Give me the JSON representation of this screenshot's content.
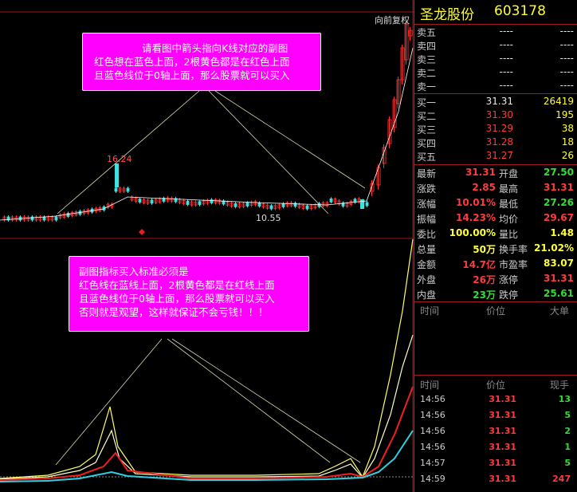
{
  "chart": {
    "mode_label": "向前复权",
    "peak_label": "16.24",
    "low_label": "10.55",
    "callout_top": [
      "请看图中箭头指向K线对应的副图",
      "红色想在蓝色上面，2根黄色都是在红色上面",
      "且蓝色线位于0轴上面，那么股票就可以买入"
    ],
    "callout_bottom": [
      "副图指标买入标准必须是",
      "红色线在蓝线上面，2根黄色都是在红线上面",
      "且蓝色线位于0轴上面，那么股票就可以买入",
      "否则就是观望，这样就保证不会亏钱！！！"
    ]
  },
  "quote": {
    "name": "圣龙股份",
    "code": "603178",
    "asks": [
      {
        "label": "卖五",
        "price": "----",
        "vol": "----"
      },
      {
        "label": "卖四",
        "price": "----",
        "vol": "----"
      },
      {
        "label": "卖三",
        "price": "----",
        "vol": "----"
      },
      {
        "label": "卖二",
        "price": "----",
        "vol": "----"
      },
      {
        "label": "卖一",
        "price": "----",
        "vol": "----"
      }
    ],
    "bids": [
      {
        "label": "买一",
        "price": "31.31",
        "vol": "26419",
        "pcolor": "white"
      },
      {
        "label": "买二",
        "price": "31.30",
        "vol": "195",
        "pcolor": "red"
      },
      {
        "label": "买三",
        "price": "31.29",
        "vol": "38",
        "pcolor": "red"
      },
      {
        "label": "买四",
        "price": "31.28",
        "vol": "18",
        "pcolor": "red"
      },
      {
        "label": "买五",
        "price": "31.27",
        "vol": "26",
        "pcolor": "red"
      }
    ],
    "stats": [
      {
        "k1": "最新",
        "v1": "31.31",
        "c1": "red",
        "k2": "开盘",
        "v2": "27.50",
        "c2": "green"
      },
      {
        "k1": "涨跌",
        "v1": "2.85",
        "c1": "red",
        "k2": "最高",
        "v2": "31.31",
        "c2": "red"
      },
      {
        "k1": "涨幅",
        "v1": "10.01%",
        "c1": "red",
        "k2": "最低",
        "v2": "27.26",
        "c2": "green"
      },
      {
        "k1": "振幅",
        "v1": "14.23%",
        "c1": "red",
        "k2": "均价",
        "v2": "29.67",
        "c2": "red"
      },
      {
        "k1": "委比",
        "v1": "100.00%",
        "c1": "yellow",
        "k2": "量比",
        "v2": "1.48",
        "c2": "yellow"
      },
      {
        "k1": "总量",
        "v1": "50万",
        "c1": "yellow",
        "k2": "换手率",
        "v2": "21.02%",
        "c2": "yellow"
      },
      {
        "k1": "金额",
        "v1": "14.7亿",
        "c1": "red",
        "k2": "市盈率",
        "v2": "83.07",
        "c2": "yellow"
      },
      {
        "k1": "外盘",
        "v1": "26万",
        "c1": "red",
        "k2": "涨停",
        "v2": "31.31",
        "c2": "red"
      },
      {
        "k1": "内盘",
        "v1": "23万",
        "c1": "green",
        "k2": "跌停",
        "v2": "25.61",
        "c2": "green"
      }
    ],
    "big_header": {
      "time": "时间",
      "price": "价位",
      "big": "大单"
    },
    "tick_header": {
      "time": "时间",
      "price": "价位",
      "vol": "现手"
    },
    "ticks": [
      {
        "time": "14:56",
        "price": "31.31",
        "vol": "13",
        "vcolor": "green"
      },
      {
        "time": "14:56",
        "price": "31.31",
        "vol": "5",
        "vcolor": "green"
      },
      {
        "time": "14:56",
        "price": "31.31",
        "vol": "2",
        "vcolor": "green"
      },
      {
        "time": "14:56",
        "price": "31.31",
        "vol": "1",
        "vcolor": "green"
      },
      {
        "time": "14:57",
        "price": "31.31",
        "vol": "5",
        "vcolor": "green"
      },
      {
        "time": "14:59",
        "price": "31.31",
        "vol": "247",
        "vcolor": "red"
      }
    ]
  }
}
